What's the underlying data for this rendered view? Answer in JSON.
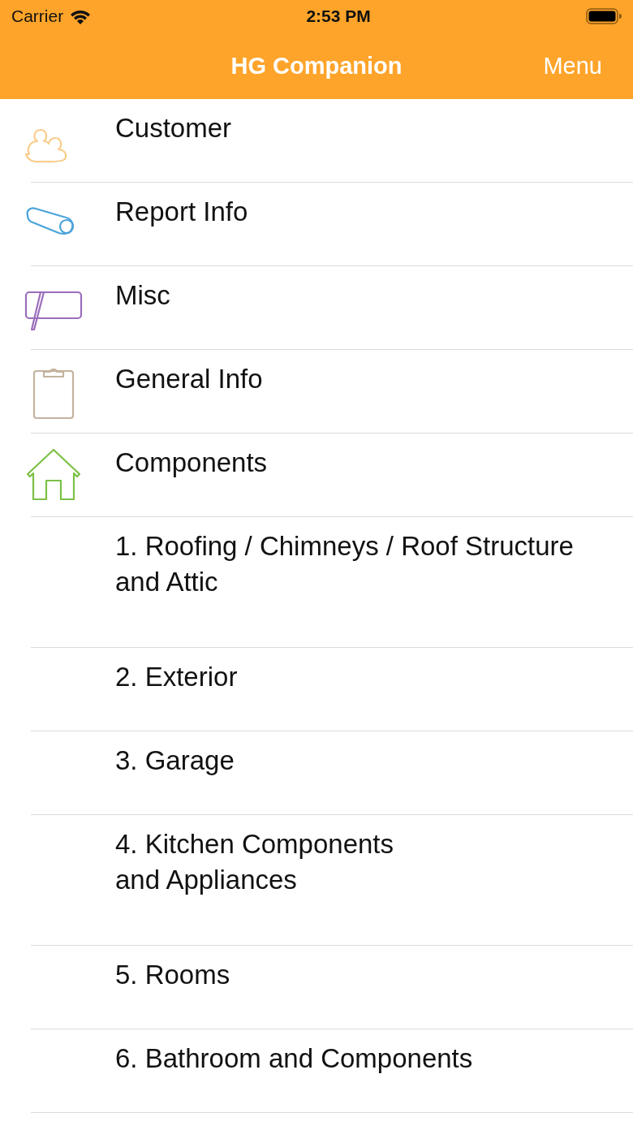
{
  "status_bar": {
    "carrier": "Carrier",
    "time": "2:53 PM"
  },
  "nav": {
    "title": "HG Companion",
    "menu": "Menu"
  },
  "items": [
    {
      "label": "Customer",
      "kind": "people"
    },
    {
      "label": "Report Info",
      "kind": "tape"
    },
    {
      "label": "Misc",
      "kind": "sign"
    },
    {
      "label": "General Info",
      "kind": "clipboard"
    },
    {
      "label": "Components",
      "kind": "house"
    },
    {
      "label": "1. Roofing / Chimneys / Roof Structure and Attic",
      "kind": "plain"
    },
    {
      "label": "2. Exterior",
      "kind": "plain"
    },
    {
      "label": "3. Garage",
      "kind": "plain"
    },
    {
      "label": "4. Kitchen Components\nand Appliances",
      "kind": "plain"
    },
    {
      "label": "5. Rooms",
      "kind": "plain"
    },
    {
      "label": "6. Bathroom and Components",
      "kind": "plain"
    }
  ]
}
